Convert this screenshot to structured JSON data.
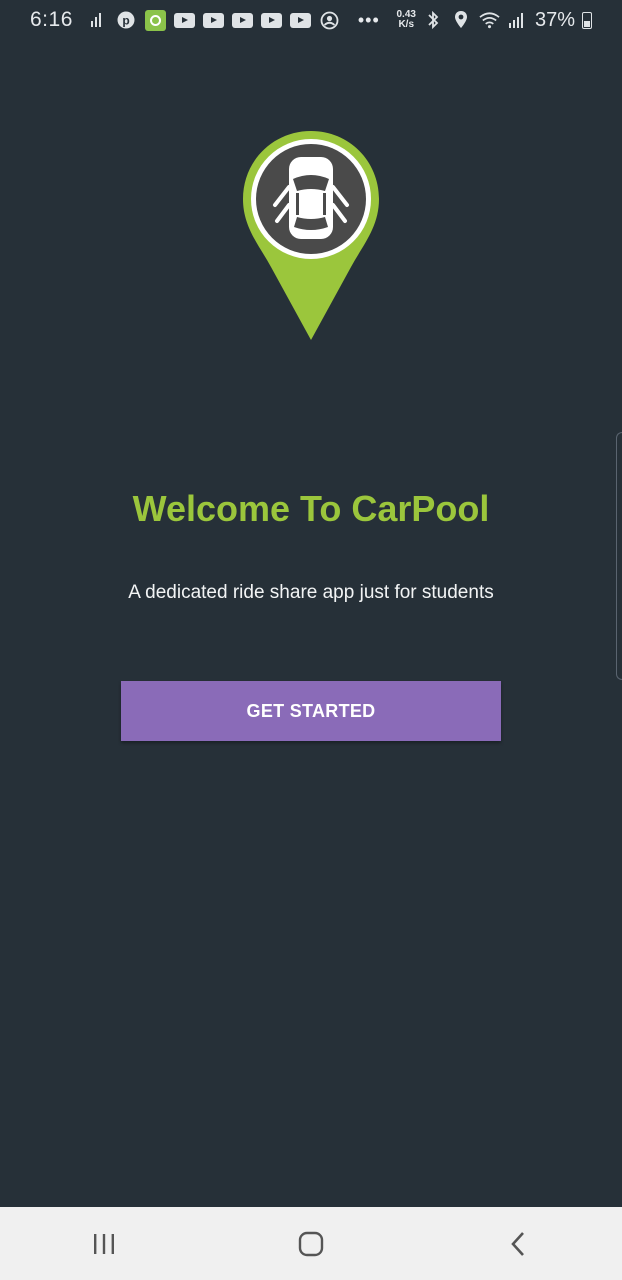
{
  "status_bar": {
    "time": "6:16",
    "network_speed_value": "0.43",
    "network_speed_unit": "K/s",
    "battery_percent": "37%"
  },
  "welcome": {
    "title": "Welcome To CarPool",
    "subtitle": "A dedicated ride share app just for students",
    "button_label": "GET STARTED"
  },
  "colors": {
    "background": "#263038",
    "accent_green": "#9bc63c",
    "button_purple": "#8a6bb8",
    "nav_bar": "#f0f0f0"
  },
  "icons": [
    "car-location-pin-icon",
    "recents-icon",
    "home-icon",
    "back-icon"
  ]
}
